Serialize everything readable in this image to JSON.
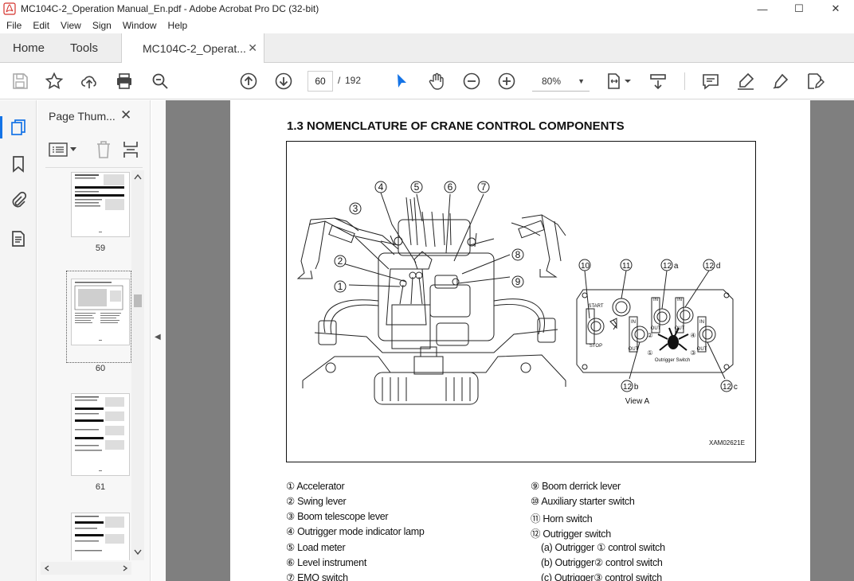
{
  "window": {
    "title": "MC104C-2_Operation Manual_En.pdf - Adobe Acrobat Pro DC (32-bit)",
    "minimize": "—",
    "maximize": "☐",
    "close": "✕"
  },
  "menu": [
    "File",
    "Edit",
    "View",
    "Sign",
    "Window",
    "Help"
  ],
  "tabs": {
    "home": "Home",
    "tools": "Tools",
    "document": "MC104C-2_Operat...",
    "close": "✕"
  },
  "toolbar": {
    "page_current": "60",
    "page_sep": "/",
    "page_total": "192",
    "zoom": "80%",
    "zoom_caret": "▼"
  },
  "thumbnail_panel": {
    "title": "Page Thum...",
    "close": "✕",
    "collapse_arrow": "◀",
    "thumbnails": [
      {
        "label": "59"
      },
      {
        "label": "60",
        "selected": true
      },
      {
        "label": "61"
      }
    ]
  },
  "document": {
    "heading": "1.3 NOMENCLATURE OF CRANE CONTROL COMPONENTS",
    "figure": {
      "view_label": "View A",
      "code": "XAM02621E",
      "callouts": [
        "1",
        "2",
        "3",
        "4",
        "5",
        "6",
        "7",
        "8",
        "9",
        "10",
        "11",
        "12 a",
        "12 d",
        "12 b",
        "12 c"
      ],
      "panel_text": [
        "START",
        "STOP",
        "IN",
        "OUT",
        "Outrigger Switch",
        "①",
        "②",
        "③",
        "④"
      ]
    },
    "legend_left": [
      "① Accelerator",
      "② Swing lever",
      "③ Boom telescope lever",
      "④ Outrigger mode indicator lamp",
      "⑤ Load meter",
      "⑥ Level instrument",
      "⑦ EMO switch"
    ],
    "legend_right": [
      "⑨ Boom derrick lever",
      "⑩ Auxiliary starter switch",
      "⑪ Horn switch",
      "⑫ Outrigger switch",
      "(a) Outrigger ① control switch",
      "(b) Outrigger② control switch",
      "(c) Outrigger③ control switch"
    ]
  }
}
